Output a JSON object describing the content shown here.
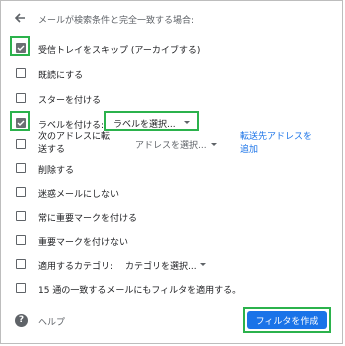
{
  "header": {
    "title": "メールが検索条件と完全一致する場合:"
  },
  "options": {
    "skip_inbox": {
      "label": "受信トレイをスキップ (アーカイブする)",
      "checked": true
    },
    "mark_read": {
      "label": "既読にする",
      "checked": false
    },
    "star": {
      "label": "スターを付ける",
      "checked": false
    },
    "apply_label": {
      "label": "ラベルを付ける:",
      "checked": true,
      "select_value": "ラベルを選択..."
    },
    "forward": {
      "label_line1": "次のアドレスに転",
      "label_line2": "送する",
      "checked": false,
      "select_value": "アドレスを選択...",
      "link_line1": "転送先アドレスを",
      "link_line2": "追加"
    },
    "delete": {
      "label": "削除する",
      "checked": false
    },
    "never_spam": {
      "label": "迷惑メールにしない",
      "checked": false
    },
    "always_important": {
      "label": "常に重要マークを付ける",
      "checked": false
    },
    "never_important": {
      "label": "重要マークを付けない",
      "checked": false
    },
    "category": {
      "label": "適用するカテゴリ:",
      "select_value": "カテゴリを選択...",
      "checked": false
    },
    "apply_existing": {
      "label": "15 通の一致するメールにもフィルタを適用する。",
      "checked": false
    }
  },
  "footer": {
    "help_label": "ヘルプ",
    "help_icon_glyph": "?",
    "create_button": "フィルタを作成"
  },
  "colors": {
    "highlight": "#2bb24c",
    "primary": "#1a73e8"
  }
}
